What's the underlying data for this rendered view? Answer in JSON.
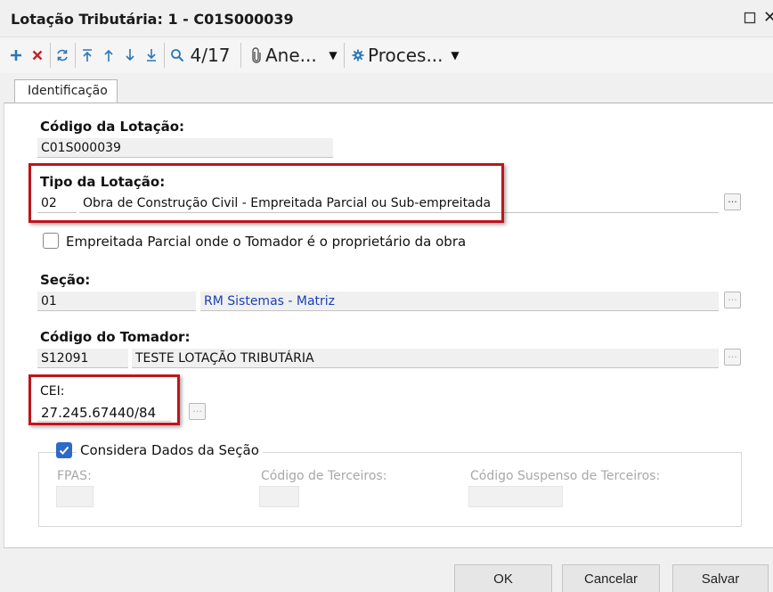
{
  "window": {
    "title": "Lotação Tributária: 1 - C01S000039"
  },
  "toolbar": {
    "record_position": "4/17",
    "annex_label": "Ane...",
    "process_label": "Proces...",
    "icons": [
      "add-icon",
      "delete-icon",
      "refresh-icon",
      "first-icon",
      "previous-icon",
      "next-icon",
      "last-icon",
      "search-icon",
      "paperclip-icon",
      "gear-icon"
    ]
  },
  "tabs": [
    {
      "label": "Identificação",
      "active": true
    }
  ],
  "form": {
    "codigo_lotacao": {
      "label": "Código da Lotação:",
      "value": "C01S000039"
    },
    "tipo_lotacao": {
      "label": "Tipo da Lotação:",
      "code": "02",
      "description": "Obra de Construção Civil - Empreitada Parcial ou Sub-empreitada"
    },
    "empreitada_checkbox": {
      "label": "Empreitada Parcial onde o Tomador é o proprietário da obra",
      "checked": false
    },
    "secao": {
      "label": "Seção:",
      "code": "01",
      "description": "RM Sistemas - Matriz"
    },
    "codigo_tomador": {
      "label": "Código do Tomador:",
      "code": "S12091",
      "description": "TESTE LOTAÇÃO TRIBUTÁRIA"
    },
    "cei": {
      "label": "CEI:",
      "value": "27.245.67440/84"
    },
    "considera_dados": {
      "label": "Considera Dados da Seção",
      "checked": true,
      "fpas_label": "FPAS:",
      "codigo_terceiros_label": "Código de Terceiros:",
      "codigo_suspenso_label": "Código Suspenso de Terceiros:"
    }
  },
  "buttons": {
    "ok": "OK",
    "cancel": "Cancelar",
    "save": "Salvar",
    "ellipsis": "..."
  },
  "colors": {
    "highlight_box": "#c0141b",
    "link_text": "#1a3fb8",
    "toolbar_icon": "#2a77b8",
    "delete_icon": "#c8202a",
    "checkbox_checked": "#2d6ac9"
  }
}
